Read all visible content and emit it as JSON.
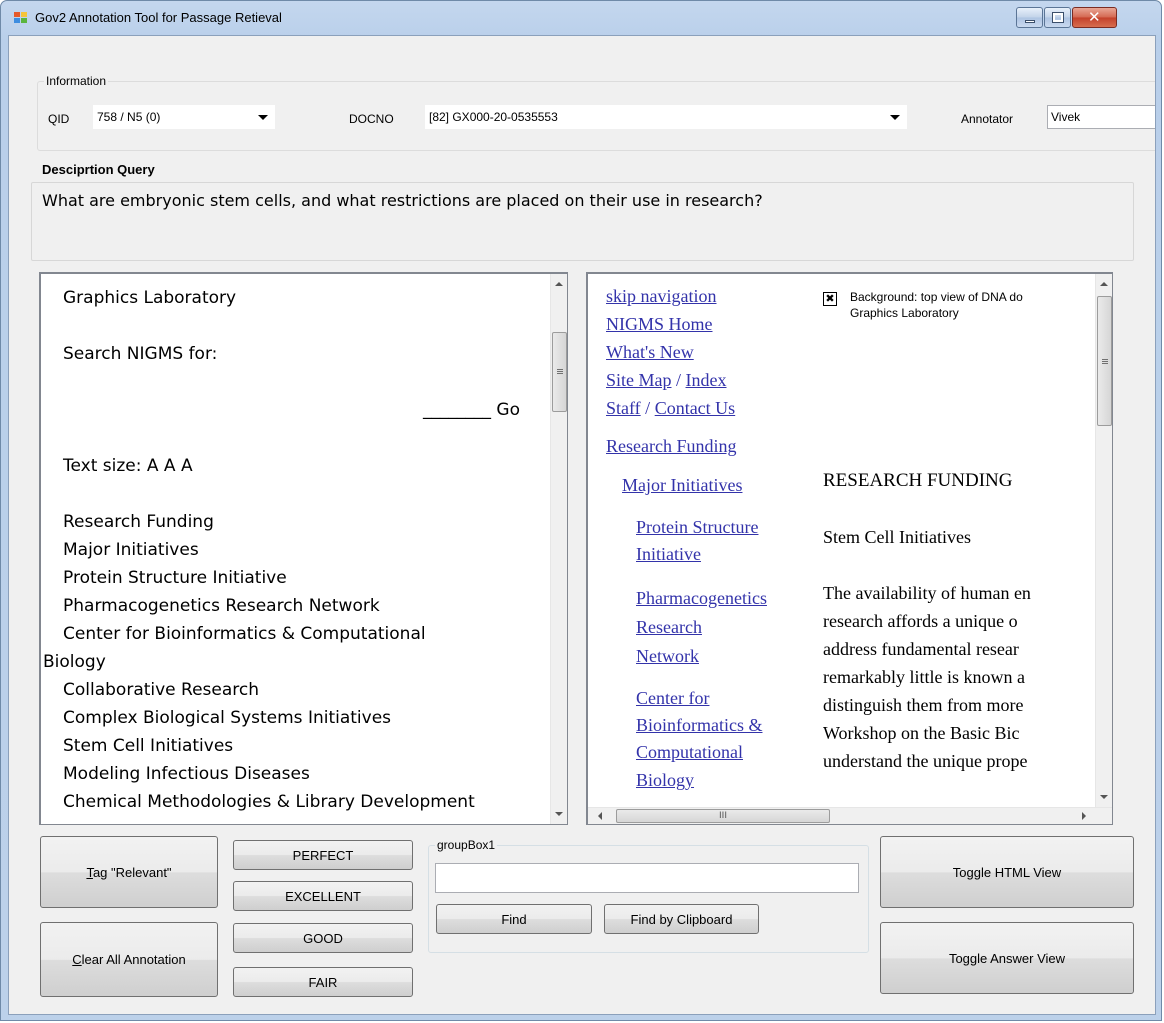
{
  "window": {
    "title": "Gov2 Annotation Tool for Passage Retieval",
    "controls": {
      "minimize": "minimize-icon",
      "maximize": "maximize-icon",
      "close": "close-icon"
    }
  },
  "info": {
    "group_label": "Information",
    "qid_label": "QID",
    "qid_value": "758 / N5 (0)",
    "docno_label": "DOCNO",
    "docno_value": "[82] GX000-20-0535553",
    "annotator_label": "Annotator",
    "annotator_value": "Vivek"
  },
  "query": {
    "label": "Desciprtion Query",
    "text": "What are embryonic stem cells, and what restrictions are placed on their use in research?"
  },
  "text_view": {
    "lines": [
      "Graphics Laboratory",
      "Search NIGMS for:",
      "________ Go",
      "Text size:  A  A  A",
      "Research Funding",
      "Major Initiatives",
      "Protein Structure Initiative",
      "Pharmacogenetics Research Network",
      "Center for Bioinformatics & Computational",
      "Biology",
      "Collaborative Research",
      "Complex Biological Systems Initiatives",
      "Stem Cell Initiatives",
      "Modeling Infectious Diseases",
      "Chemical Methodologies & Library Development"
    ]
  },
  "html_view": {
    "nav_links": [
      "skip navigation",
      "NIGMS Home",
      "What's New"
    ],
    "site_map": "Site Map",
    "sep1": " / ",
    "index": "Index",
    "staff": "Staff",
    "sep2": " / ",
    "contact": "Contact Us",
    "research_funding": "Research Funding",
    "major_initiatives": "Major Initiatives",
    "sub_links": [
      [
        "Protein Structure",
        "Initiative"
      ],
      [
        "Pharmacogenetics",
        "Research",
        "Network"
      ],
      [
        "Center for",
        "Bioinformatics &",
        "Computational",
        "Biology"
      ]
    ],
    "image_alt_1": "Background: top view of DNA do",
    "image_alt_2": "Graphics Laboratory",
    "heading": "RESEARCH FUNDING",
    "subheading": "Stem Cell Initiatives",
    "body_lines": [
      "The availability of human en",
      "research affords a unique o",
      "address fundamental resear",
      "remarkably little is known a",
      "distinguish them from more",
      "Workshop on the Basic Bic",
      "understand the unique prope"
    ],
    "hscroll_grip": "III"
  },
  "buttons": {
    "tag_relevant_mnemonic": "T",
    "tag_relevant_rest": "ag \"Relevant\"",
    "clear_mnemonic": "C",
    "clear_rest": "lear All Annotation",
    "perfect": "PERFECT",
    "excellent": "EXCELLENT",
    "good": "GOOD",
    "fair": "FAIR",
    "find": "Find",
    "find_clipboard": "Find by Clipboard",
    "toggle_html": "Toggle HTML View",
    "toggle_answer": "Toggle Answer View"
  },
  "find_group": {
    "label": "groupBox1",
    "input_value": ""
  }
}
